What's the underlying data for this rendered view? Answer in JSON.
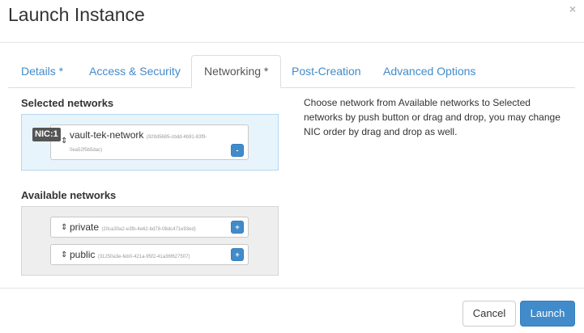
{
  "modal": {
    "title": "Launch Instance",
    "close_label": "×"
  },
  "tabs": [
    {
      "label": "Details *",
      "active": false
    },
    {
      "label": "Access & Security",
      "active": false
    },
    {
      "label": "Networking *",
      "active": true
    },
    {
      "label": "Post-Creation",
      "active": false
    },
    {
      "label": "Advanced Options",
      "active": false
    }
  ],
  "selected_networks": {
    "title": "Selected networks",
    "items": [
      {
        "nic": "NIC:1",
        "name": "vault-tek-network",
        "id": "(929d5685-cbdd-4b91-83f9-0ea52f5b5dac)",
        "id_line1": "(929d5685-cbdd-4b91-83f9-",
        "id_line2": "0ea52f5b5dac)",
        "button": "-"
      }
    ]
  },
  "available_networks": {
    "title": "Available networks",
    "items": [
      {
        "name": "private",
        "id": "(20ca30a2-e3fb-4e62-bd78-08dc471e93ed)",
        "button": "+"
      },
      {
        "name": "public",
        "id": "(31250a3e-feb0-421a-95f2-41a36f627507)",
        "button": "+"
      }
    ]
  },
  "help": {
    "text": "Choose network from Available networks to Selected networks by push button or drag and drop, you may change NIC order by drag and drop as well."
  },
  "footer": {
    "cancel_label": "Cancel",
    "launch_label": "Launch"
  },
  "colors": {
    "accent": "#428bca",
    "selected_bg": "#e8f4fc",
    "available_bg": "#eeeeee"
  }
}
